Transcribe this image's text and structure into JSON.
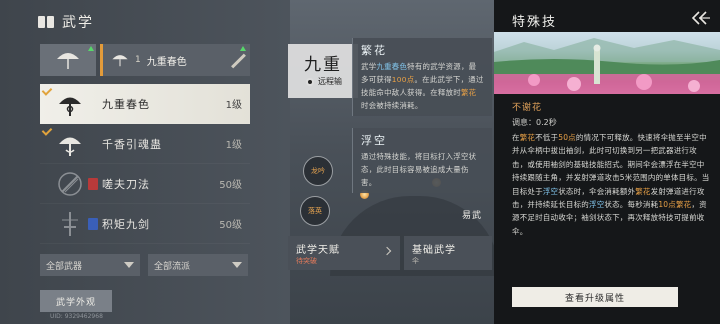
{
  "header": {
    "title": "武学",
    "icon": "book-icon"
  },
  "equip_bar": {
    "num": "1",
    "name": "九重春色"
  },
  "skills": [
    {
      "name": "九重春色",
      "level": "1级",
      "tag": "",
      "tag_color": ""
    },
    {
      "name": "千香引魂蛊",
      "level": "1级",
      "tag": "",
      "tag_color": ""
    },
    {
      "name": "嗟夫刀法",
      "level": "50级",
      "tag": "",
      "tag_color": "#b83a3a"
    },
    {
      "name": "积矩九剑",
      "level": "50级",
      "tag": "",
      "tag_color": "#3a5fb8"
    }
  ],
  "filters": {
    "weapon": "全部武器",
    "school": "全部流派"
  },
  "appearance_btn": "武学外观",
  "uid": "UID: 9329462968",
  "center": {
    "skill_title": "九重",
    "skill_sub": "远程输",
    "node_labels": [
      "龙吟",
      "落英"
    ],
    "side_label": "易武",
    "cards": [
      {
        "title": "武学天赋",
        "sub": "待突破"
      },
      {
        "title": "基础武学",
        "sub": "伞"
      }
    ]
  },
  "tips": [
    {
      "title": "繁花",
      "body_parts": [
        {
          "t": "武学",
          "c": ""
        },
        {
          "t": "九重春色",
          "c": "hl2"
        },
        {
          "t": "特有的武学资源，最多可获得",
          "c": ""
        },
        {
          "t": "100点",
          "c": "hl"
        },
        {
          "t": "。在此武学下，通过技能命中敌人获得。在释放时",
          "c": ""
        },
        {
          "t": "繁花",
          "c": "hl"
        },
        {
          "t": "时会被持续消耗。",
          "c": ""
        }
      ]
    },
    {
      "title": "浮空",
      "body_parts": [
        {
          "t": "通过特殊技能，将目标打入浮空状态，此时目标容易被追成大量伤害。",
          "c": ""
        }
      ]
    }
  ],
  "right_panel": {
    "title": "特殊技",
    "skill_name": "不谢花",
    "cooldown": "调息：0.2秒",
    "desc_parts": [
      {
        "t": "在",
        "c": ""
      },
      {
        "t": "繁花",
        "c": "hl"
      },
      {
        "t": "不低于",
        "c": ""
      },
      {
        "t": "50点",
        "c": "hl"
      },
      {
        "t": "的情况下可释放。快速将伞抛至半空中并从伞柄中拔出袖剑，此时可切换到另一把武器进行攻击，或使用袖剑的基础技能招式。期间伞会漂浮在半空中持续跟随主角，并发射弹道攻击5米范围内的单体目标。当目标处于",
        "c": ""
      },
      {
        "t": "浮空",
        "c": "hl2"
      },
      {
        "t": "状态时，伞会消耗额外",
        "c": ""
      },
      {
        "t": "繁花",
        "c": "hl"
      },
      {
        "t": "发射弹道进行攻击，并持续延长目标的",
        "c": ""
      },
      {
        "t": "浮空",
        "c": "hl2"
      },
      {
        "t": "状态。每秒消耗",
        "c": ""
      },
      {
        "t": "10点",
        "c": "hl"
      },
      {
        "t": "繁花",
        "c": "hl"
      },
      {
        "t": "，资源不足时自动收伞；袖剑状态下，再次释放特技可提前收伞。",
        "c": ""
      }
    ],
    "upgrade_btn": "查看升级属性"
  },
  "colors": {
    "accent": "#e39b3a",
    "highlight": "#e9a146",
    "link_blue": "#83c7ee",
    "panel_dark": "#151719"
  }
}
